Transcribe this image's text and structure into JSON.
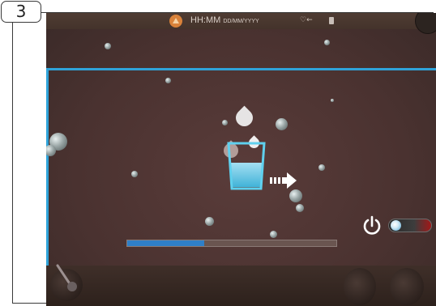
{
  "figure": {
    "step_number": "3"
  },
  "status_bar": {
    "time_label": "HH:MM",
    "date_label": "DD/MM/YYYY",
    "hotspot_glyph": "♡←"
  },
  "dispense": {
    "progress_fraction": 0.37,
    "accent_color": "#2fa3d9",
    "water_color": "#41b3d8"
  },
  "power": {
    "state": "off"
  },
  "icons": [
    "warning-icon",
    "hotspot-icon",
    "cup-icon",
    "water-drop-icon",
    "glass-icon",
    "dispense-arrow-icon",
    "power-icon",
    "toggle-switch",
    "knob-icon"
  ]
}
